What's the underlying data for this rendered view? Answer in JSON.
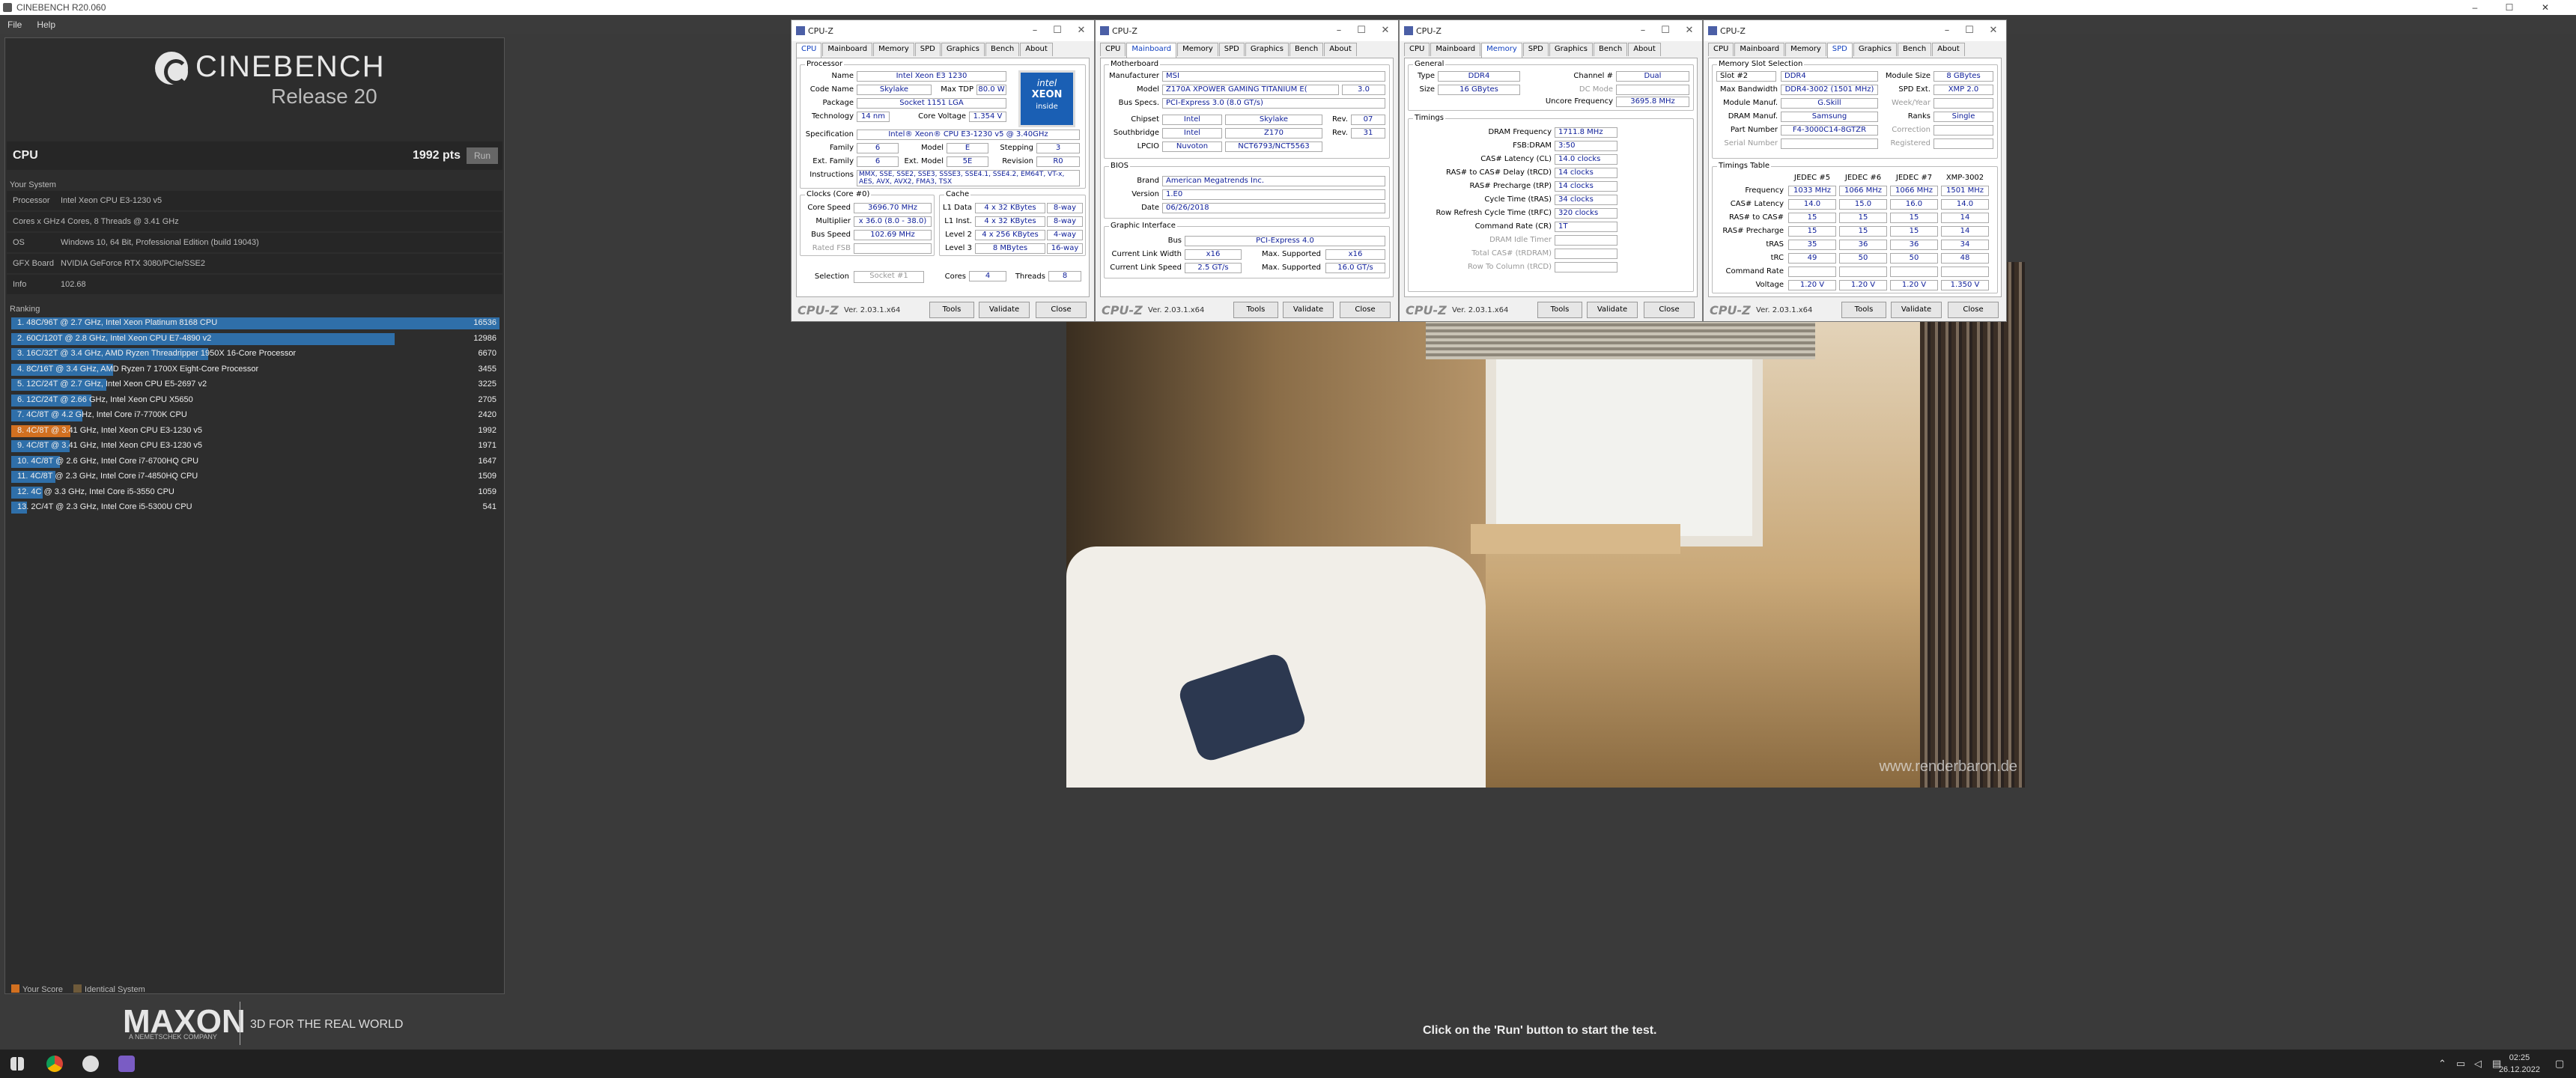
{
  "window": {
    "title": "CINEBENCH R20.060",
    "min": "–",
    "max": "☐",
    "close": "✕"
  },
  "menu": {
    "file": "File",
    "help": "Help"
  },
  "logo": {
    "title": "CINEBENCH",
    "release": "Release 20"
  },
  "cpu": {
    "label": "CPU",
    "score": "1992 pts",
    "run": "Run"
  },
  "system": {
    "title": "Your System",
    "rows": [
      {
        "k": "Processor",
        "v": "Intel Xeon CPU E3-1230 v5"
      },
      {
        "k": "Cores x GHz",
        "v": "4 Cores, 8 Threads @ 3.41 GHz"
      },
      {
        "k": "OS",
        "v": "Windows 10, 64 Bit, Professional Edition (build 19043)"
      },
      {
        "k": "GFX Board",
        "v": "NVIDIA GeForce RTX 3080/PCIe/SSE2"
      },
      {
        "k": "Info",
        "v": "102.68"
      }
    ]
  },
  "ranking": {
    "title": "Ranking",
    "max": 16536,
    "rows": [
      {
        "name": "1. 48C/96T @ 2.7 GHz, Intel Xeon Platinum 8168 CPU",
        "score": "16536",
        "v": 16536,
        "me": false
      },
      {
        "name": "2. 60C/120T @ 2.8 GHz, Intel Xeon CPU E7-4890 v2",
        "score": "12986",
        "v": 12986,
        "me": false
      },
      {
        "name": "3. 16C/32T @ 3.4 GHz, AMD Ryzen Threadripper 1950X 16-Core Processor",
        "score": "6670",
        "v": 6670,
        "me": false
      },
      {
        "name": "4. 8C/16T @ 3.4 GHz, AMD Ryzen 7 1700X Eight-Core Processor",
        "score": "3455",
        "v": 3455,
        "me": false
      },
      {
        "name": "5. 12C/24T @ 2.7 GHz, Intel Xeon CPU E5-2697 v2",
        "score": "3225",
        "v": 3225,
        "me": false
      },
      {
        "name": "6. 12C/24T @ 2.66 GHz, Intel Xeon CPU X5650",
        "score": "2705",
        "v": 2705,
        "me": false
      },
      {
        "name": "7. 4C/8T @ 4.2 GHz, Intel Core i7-7700K CPU",
        "score": "2420",
        "v": 2420,
        "me": false
      },
      {
        "name": "8. 4C/8T @ 3.41 GHz, Intel Xeon CPU E3-1230 v5",
        "score": "1992",
        "v": 1992,
        "me": true
      },
      {
        "name": "9. 4C/8T @ 3.41 GHz, Intel Xeon CPU E3-1230 v5",
        "score": "1971",
        "v": 1971,
        "me": false
      },
      {
        "name": "10. 4C/8T @ 2.6 GHz, Intel Core i7-6700HQ CPU",
        "score": "1647",
        "v": 1647,
        "me": false
      },
      {
        "name": "11. 4C/8T @ 2.3 GHz, Intel Core i7-4850HQ CPU",
        "score": "1509",
        "v": 1509,
        "me": false
      },
      {
        "name": "12. 4C @ 3.3 GHz, Intel Core i5-3550 CPU",
        "score": "1059",
        "v": 1059,
        "me": false
      },
      {
        "name": "13. 2C/4T @ 2.3 GHz, Intel Core i5-5300U CPU",
        "score": "541",
        "v": 541,
        "me": false
      }
    ]
  },
  "legend": {
    "your": "Your Score",
    "identical": "Identical System",
    "your_color": "#d27020",
    "identical_color": "#6e5a3a"
  },
  "brand": {
    "maxon": "MAXON",
    "sub": "A NEMETSCHEK COMPANY",
    "tagline": "3D FOR THE REAL WORLD"
  },
  "hint": "Click on the 'Run' button to start the test.",
  "render": {
    "watermark": "www.renderbaron.de"
  },
  "taskbar": {
    "time": "02:25",
    "date": "26.12.2022"
  },
  "cpuz_common": {
    "title": "CPU-Z",
    "brand": "CPU-Z",
    "ver": "Ver. 2.03.1.x64",
    "tools": "Tools",
    "validate": "Validate",
    "close": "Close",
    "tabs": [
      "CPU",
      "Mainboard",
      "Memory",
      "SPD",
      "Graphics",
      "Bench",
      "About"
    ]
  },
  "cpuz1": {
    "processor": "Processor",
    "name_l": "Name",
    "name": "Intel Xeon E3 1230",
    "codename_l": "Code Name",
    "codename": "Skylake",
    "tdp_l": "Max TDP",
    "tdp": "80.0 W",
    "package_l": "Package",
    "package": "Socket 1151 LGA",
    "tech_l": "Technology",
    "tech": "14 nm",
    "cv_l": "Core Voltage",
    "cv": "1.354 V",
    "spec_l": "Specification",
    "spec": "Intel® Xeon® CPU E3-1230 v5 @ 3.40GHz",
    "family_l": "Family",
    "family": "6",
    "model_l": "Model",
    "model": "E",
    "stepping_l": "Stepping",
    "stepping": "3",
    "extfam_l": "Ext. Family",
    "extfam": "6",
    "extmod_l": "Ext. Model",
    "extmod": "5E",
    "rev_l": "Revision",
    "rev": "R0",
    "instr_l": "Instructions",
    "instr": "MMX, SSE, SSE2, SSE3, SSSE3, SSE4.1, SSE4.2, EM64T, VT-x, AES, AVX, AVX2, FMA3, TSX",
    "clocks": "Clocks (Core #0)",
    "cache": "Cache",
    "cs_l": "Core Speed",
    "cs": "3696.70 MHz",
    "mult_l": "Multiplier",
    "mult": "x 36.0 (8.0 - 38.0)",
    "bus_l": "Bus Speed",
    "bus": "102.69 MHz",
    "fsb_l": "Rated FSB",
    "l1d_l": "L1 Data",
    "l1d": "4 x 32 KBytes",
    "l1d_w": "8-way",
    "l1i_l": "L1 Inst.",
    "l1i": "4 x 32 KBytes",
    "l1i_w": "8-way",
    "l2_l": "Level 2",
    "l2": "4 x 256 KBytes",
    "l2_w": "4-way",
    "l3_l": "Level 3",
    "l3": "8 MBytes",
    "l3_w": "16-way",
    "sel_l": "Selection",
    "sel": "Socket #1",
    "cores_l": "Cores",
    "cores": "4",
    "threads_l": "Threads",
    "threads": "8",
    "badge1": "intel",
    "badge2": "XEON",
    "badge3": "inside"
  },
  "cpuz2": {
    "mb": "Motherboard",
    "man_l": "Manufacturer",
    "man": "MSI",
    "model_l": "Model",
    "model": "Z170A XPOWER GAMING TITANIUM E(",
    "model_rev": "3.0",
    "busspec_l": "Bus Specs.",
    "busspec": "PCI-Express 3.0 (8.0 GT/s)",
    "chip_l": "Chipset",
    "chip": "Intel",
    "chip2": "Skylake",
    "chiprev_l": "Rev.",
    "chiprev": "07",
    "south_l": "Southbridge",
    "south": "Intel",
    "south2": "Z170",
    "southrev_l": "Rev.",
    "southrev": "31",
    "lpc_l": "LPCIO",
    "lpc": "Nuvoton",
    "lpc2": "NCT6793/NCT5563",
    "bios": "BIOS",
    "brand_l": "Brand",
    "brand": "American Megatrends Inc.",
    "ver_l": "Version",
    "ver": "1.E0",
    "date_l": "Date",
    "date": "06/26/2018",
    "gi": "Graphic Interface",
    "gbus_l": "Bus",
    "gbus": "PCI-Express 4.0",
    "clw_l": "Current Link Width",
    "clw": "x16",
    "msw_l": "Max. Supported",
    "msw": "x16",
    "cls_l": "Current Link Speed",
    "cls": "2.5 GT/s",
    "mss_l": "Max. Supported",
    "mss": "16.0 GT/s"
  },
  "cpuz3": {
    "general": "General",
    "type_l": "Type",
    "type": "DDR4",
    "ch_l": "Channel #",
    "ch": "Dual",
    "size_l": "Size",
    "size": "16 GBytes",
    "dc_l": "DC Mode",
    "unc_l": "Uncore Frequency",
    "unc": "3695.8 MHz",
    "timings": "Timings",
    "rows": [
      {
        "l": "DRAM Frequency",
        "v": "1711.8 MHz",
        "dim": false
      },
      {
        "l": "FSB:DRAM",
        "v": "3:50",
        "dim": false
      },
      {
        "l": "CAS# Latency (CL)",
        "v": "14.0 clocks",
        "dim": false
      },
      {
        "l": "RAS# to CAS# Delay (tRCD)",
        "v": "14 clocks",
        "dim": false
      },
      {
        "l": "RAS# Precharge (tRP)",
        "v": "14 clocks",
        "dim": false
      },
      {
        "l": "Cycle Time (tRAS)",
        "v": "34 clocks",
        "dim": false
      },
      {
        "l": "Row Refresh Cycle Time (tRFC)",
        "v": "320 clocks",
        "dim": false
      },
      {
        "l": "Command Rate (CR)",
        "v": "1T",
        "dim": false
      },
      {
        "l": "DRAM Idle Timer",
        "v": "",
        "dim": true
      },
      {
        "l": "Total CAS# (tRDRAM)",
        "v": "",
        "dim": true
      },
      {
        "l": "Row To Column (tRCD)",
        "v": "",
        "dim": true
      }
    ]
  },
  "cpuz4": {
    "mss": "Memory Slot Selection",
    "slot": "Slot #2",
    "type": "DDR4",
    "modsize_l": "Module Size",
    "modsize": "8 GBytes",
    "maxbw_l": "Max Bandwidth",
    "maxbw": "DDR4-3002 (1501 MHz)",
    "spdext_l": "SPD Ext.",
    "spdext": "XMP 2.0",
    "modman_l": "Module Manuf.",
    "modman": "G.Skill",
    "week_l": "Week/Year",
    "dramman_l": "DRAM Manuf.",
    "dramman": "Samsung",
    "ranks_l": "Ranks",
    "ranks": "Single",
    "pn_l": "Part Number",
    "pn": "F4-3000C14-8GTZR",
    "corr_l": "Correction",
    "sn_l": "Serial Number",
    "reg_l": "Registered",
    "tt": "Timings Table",
    "cols": [
      "JEDEC #5",
      "JEDEC #6",
      "JEDEC #7",
      "XMP-3002"
    ],
    "rows": [
      {
        "l": "Frequency",
        "v": [
          "1033 MHz",
          "1066 MHz",
          "1066 MHz",
          "1501 MHz"
        ]
      },
      {
        "l": "CAS# Latency",
        "v": [
          "14.0",
          "15.0",
          "16.0",
          "14.0"
        ]
      },
      {
        "l": "RAS# to CAS#",
        "v": [
          "15",
          "15",
          "15",
          "14"
        ]
      },
      {
        "l": "RAS# Precharge",
        "v": [
          "15",
          "15",
          "15",
          "14"
        ]
      },
      {
        "l": "tRAS",
        "v": [
          "35",
          "36",
          "36",
          "34"
        ]
      },
      {
        "l": "tRC",
        "v": [
          "49",
          "50",
          "50",
          "48"
        ]
      },
      {
        "l": "Command Rate",
        "v": [
          "",
          "",
          "",
          ""
        ]
      },
      {
        "l": "Voltage",
        "v": [
          "1.20 V",
          "1.20 V",
          "1.20 V",
          "1.350 V"
        ]
      }
    ]
  }
}
